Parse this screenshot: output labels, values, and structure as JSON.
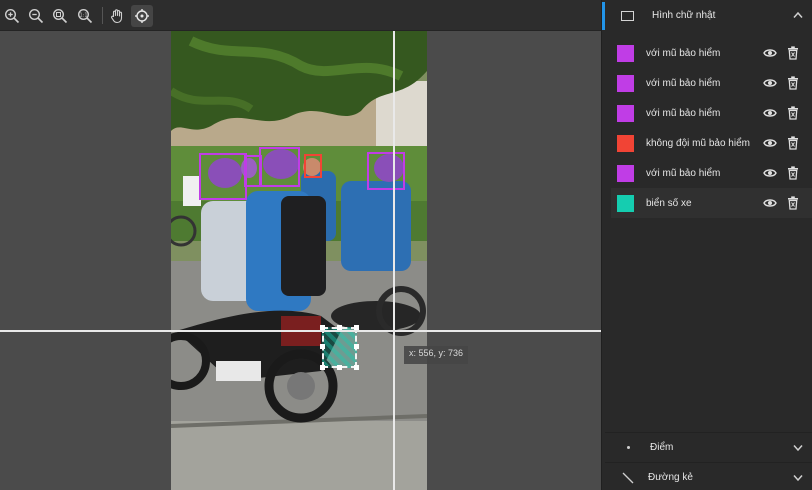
{
  "toolbar": {
    "tools": [
      "zoom-in",
      "zoom-out",
      "zoom-fit",
      "zoom-actual",
      "pan",
      "crosshair"
    ],
    "active_tool": "crosshair"
  },
  "canvas": {
    "cursor_readout": "x: 556, y: 736"
  },
  "panel": {
    "title": "Hình chữ nhật",
    "annotations": [
      {
        "label": "với mũ bảo hiểm",
        "color": "#c03de6"
      },
      {
        "label": "với mũ bảo hiểm",
        "color": "#c03de6"
      },
      {
        "label": "với mũ bảo hiểm",
        "color": "#c03de6"
      },
      {
        "label": "không đội mũ bảo hiểm",
        "color": "#f14435"
      },
      {
        "label": "với mũ bảo hiểm",
        "color": "#c03de6"
      },
      {
        "label": "biển số xe",
        "color": "#15cdb0"
      }
    ],
    "sections": [
      {
        "label": "Điểm",
        "icon": "point-icon"
      },
      {
        "label": "Đường kẻ",
        "icon": "line-icon"
      }
    ]
  },
  "colors": {
    "with_helmet": "#c03de6",
    "no_helmet": "#f14435",
    "license_plate": "#15cdb0",
    "accent": "#2294e8"
  }
}
